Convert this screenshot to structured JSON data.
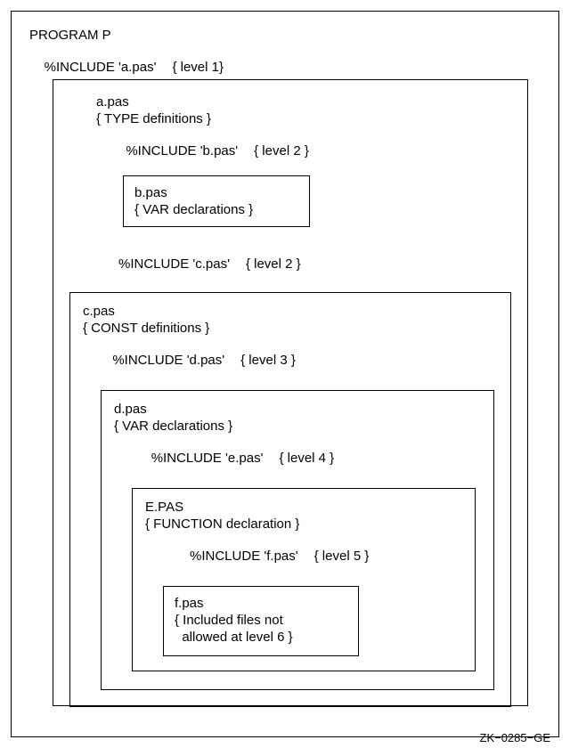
{
  "header": {
    "program_line": "PROGRAM P",
    "include_a": "%INCLUDE 'a.pas'",
    "level1": "{ level 1}"
  },
  "a": {
    "filename": "a.pas",
    "typedefs": "{ TYPE definitions }",
    "include_b": "%INCLUDE 'b.pas'",
    "level2_b": "{ level 2 }",
    "include_c": "%INCLUDE 'c.pas'",
    "level2_c": "{ level 2 }"
  },
  "b": {
    "filename": "b.pas",
    "vardecls": "{ VAR declarations }"
  },
  "c": {
    "filename": "c.pas",
    "constdefs": "{ CONST definitions }",
    "include_d": "%INCLUDE 'd.pas'",
    "level3": "{ level 3 }"
  },
  "d": {
    "filename": "d.pas",
    "vardecls": "{ VAR declarations }",
    "include_e": "%INCLUDE 'e.pas'",
    "level4": "{ level 4 }"
  },
  "e": {
    "filename": "E.PAS",
    "funcdecl": "{ FUNCTION declaration }",
    "include_f": "%INCLUDE 'f.pas'",
    "level5": "{ level 5 }"
  },
  "f": {
    "filename": "f.pas",
    "note1": "{ Included files not",
    "note2": "  allowed at level 6 }"
  },
  "figure_id": "ZK−0285−GE"
}
